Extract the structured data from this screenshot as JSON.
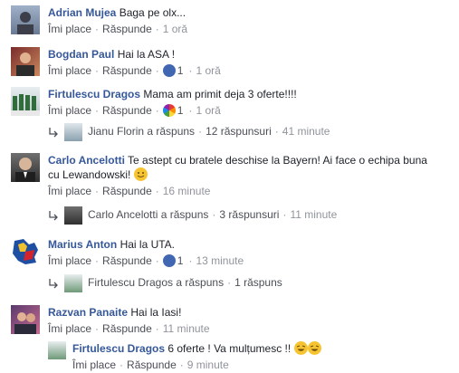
{
  "common": {
    "like": "Îmi place",
    "reply": "Răspunde",
    "sep": "·"
  },
  "colors": {
    "name": "#365899",
    "meta": "#90949c",
    "like_reaction": "#4267b2"
  },
  "comments": [
    {
      "author": "Adrian Mujea",
      "text": "Baga pe olx...",
      "time": "1 oră"
    },
    {
      "author": "Bogdan Paul",
      "text": "Hai la ASA !",
      "reaction_icon": "like-icon",
      "reactions": "1",
      "time": "1 oră"
    },
    {
      "author": "Firtulescu Dragos",
      "text": "Mama am primit deja 3 oferte!!!!",
      "reaction_icon": "rainbow-reaction-icon",
      "reactions": "1",
      "time": "1 oră",
      "replies": {
        "who": "Jianu Florin a răspuns",
        "count": "12 răspunsuri",
        "time": "41 minute"
      }
    },
    {
      "author": "Carlo Ancelotti",
      "text_line1": "Te astept cu bratele deschise la Bayern! Ai face o echipa buna",
      "text_line2": "cu Lewandowski!",
      "time": "16 minute",
      "replies": {
        "who": "Carlo Ancelotti a răspuns",
        "count": "3 răspunsuri",
        "time": "11 minute"
      }
    },
    {
      "author": "Marius Anton",
      "text": "Hai la UTA.",
      "reaction_icon": "like-icon",
      "reactions": "1",
      "time": "13 minute",
      "replies": {
        "who": "Firtulescu Dragos a răspuns",
        "count": "1 răspuns"
      }
    },
    {
      "author": "Razvan Panaite",
      "text": "Hai la Iasi!",
      "time": "11 minute",
      "reply": {
        "author": "Firtulescu Dragos",
        "text": "6 oferte ! Va mulțumesc !!",
        "time": "9 minute"
      }
    }
  ]
}
